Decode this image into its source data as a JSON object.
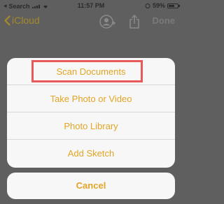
{
  "status_bar": {
    "carrier": "Search",
    "time": "11:57 PM",
    "battery": "59%"
  },
  "nav": {
    "back_label": "iCloud",
    "done_label": "Done",
    "icons": [
      "chevron-left-icon",
      "add-person-icon",
      "share-icon"
    ]
  },
  "sheet": {
    "options": [
      "Scan Documents",
      "Take Photo or Video",
      "Photo Library",
      "Add Sketch"
    ]
  },
  "cancel_label": "Cancel",
  "colors": {
    "accent": "#e2a525",
    "highlight": "#e85a5a",
    "sheet_background": "#f7f7f7",
    "backdrop": "#5f5f5f"
  }
}
